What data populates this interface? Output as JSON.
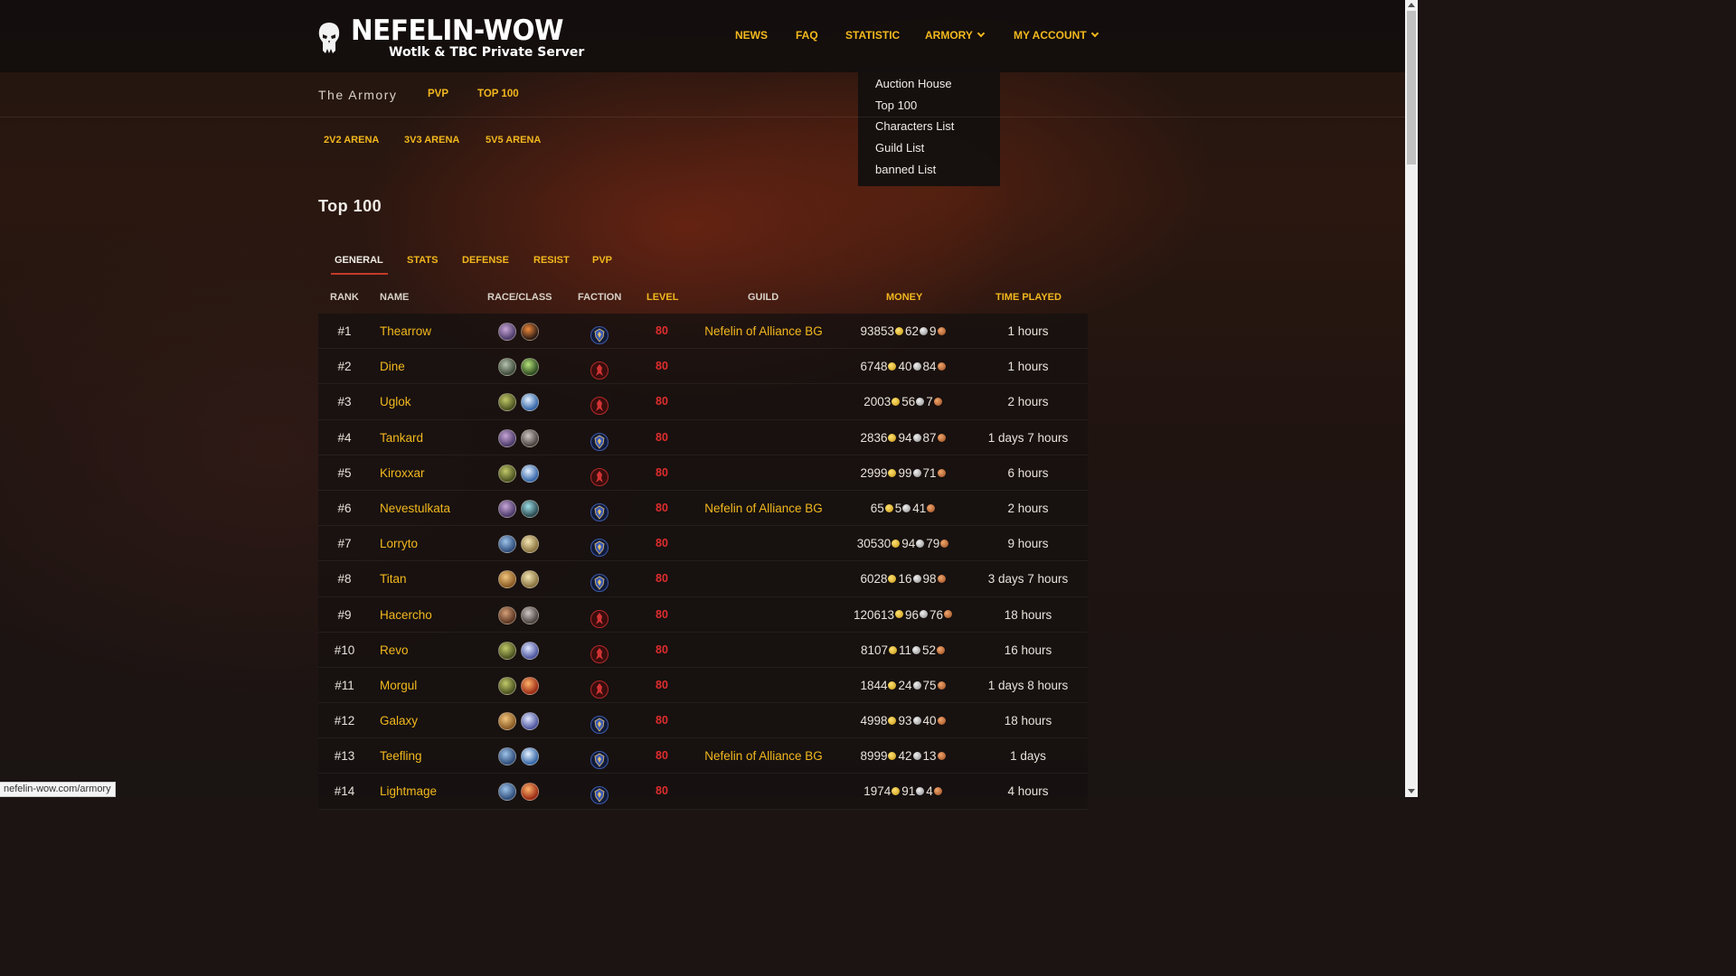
{
  "logo": {
    "title": "NEFELIN-WOW",
    "subtitle": "Wotlk & TBC Private Server"
  },
  "nav": {
    "news": "NEWS",
    "faq": "FAQ",
    "statistic": "STATISTIC",
    "armory": "ARMORY",
    "account": "MY ACCOUNT"
  },
  "dropdown": [
    "Auction House",
    "Top 100",
    "Characters List",
    "Guild List",
    "banned List"
  ],
  "subbar": {
    "title": "The Armory",
    "pvp": "PVP",
    "top100": "TOP 100"
  },
  "arena": [
    "2V2 ARENA",
    "3V3 ARENA",
    "5V5 ARENA"
  ],
  "page_title": "Top 100",
  "tabs": [
    "GENERAL",
    "STATS",
    "DEFENSE",
    "RESIST",
    "PVP"
  ],
  "columns": {
    "rank": "RANK",
    "name": "NAME",
    "raceclass": "RACE/CLASS",
    "faction": "FACTION",
    "level": "LEVEL",
    "guild": "GUILD",
    "money": "MONEY",
    "time": "TIME PLAYED"
  },
  "colors": {
    "accent": "#f2b81e",
    "level": "#e02d2d",
    "tab_underline": "#c43b2a"
  },
  "rows": [
    {
      "rank": "#1",
      "name": "Thearrow",
      "race": "race-draenei",
      "cls": "class-rogue",
      "faction": "alliance",
      "level": "80",
      "guild": "Nefelin of Alliance BG",
      "gold": "93853",
      "silver": "62",
      "copper": "9",
      "time": "1 hours"
    },
    {
      "rank": "#2",
      "name": "Dine",
      "race": "race-undead",
      "cls": "class-hunter",
      "faction": "horde",
      "level": "80",
      "guild": "",
      "gold": "6748",
      "silver": "40",
      "copper": "84",
      "time": "1 hours"
    },
    {
      "rank": "#3",
      "name": "Uglok",
      "race": "race-orc",
      "cls": "class-shaman",
      "faction": "horde",
      "level": "80",
      "guild": "",
      "gold": "2003",
      "silver": "56",
      "copper": "7",
      "time": "2 hours"
    },
    {
      "rank": "#4",
      "name": "Tankard",
      "race": "race-draenei",
      "cls": "class-warrior",
      "faction": "alliance",
      "level": "80",
      "guild": "",
      "gold": "2836",
      "silver": "94",
      "copper": "87",
      "time": "1 days 7 hours"
    },
    {
      "rank": "#5",
      "name": "Kiroxxar",
      "race": "race-orc",
      "cls": "class-shaman",
      "faction": "horde",
      "level": "80",
      "guild": "",
      "gold": "2999",
      "silver": "99",
      "copper": "71",
      "time": "6 hours"
    },
    {
      "rank": "#6",
      "name": "Nevestulkata",
      "race": "race-draenei",
      "cls": "class-deathknight",
      "faction": "alliance",
      "level": "80",
      "guild": "Nefelin of Alliance BG",
      "gold": "65",
      "silver": "5",
      "copper": "41",
      "time": "2 hours"
    },
    {
      "rank": "#7",
      "name": "Lorryto",
      "race": "race-gnome",
      "cls": "class-paladin",
      "faction": "alliance",
      "level": "80",
      "guild": "",
      "gold": "30530",
      "silver": "94",
      "copper": "79",
      "time": "9 hours"
    },
    {
      "rank": "#8",
      "name": "Titan",
      "race": "race-human",
      "cls": "class-paladin",
      "faction": "alliance",
      "level": "80",
      "guild": "",
      "gold": "6028",
      "silver": "16",
      "copper": "98",
      "time": "3 days 7 hours"
    },
    {
      "rank": "#9",
      "name": "Hacercho",
      "race": "race-tauren",
      "cls": "class-warrior",
      "faction": "horde",
      "level": "80",
      "guild": "",
      "gold": "120613",
      "silver": "96",
      "copper": "76",
      "time": "18 hours"
    },
    {
      "rank": "#10",
      "name": "Revo",
      "race": "race-orc",
      "cls": "class-priest",
      "faction": "horde",
      "level": "80",
      "guild": "",
      "gold": "8107",
      "silver": "11",
      "copper": "52",
      "time": "16 hours"
    },
    {
      "rank": "#11",
      "name": "Morgul",
      "race": "race-orc",
      "cls": "class-mage",
      "faction": "horde",
      "level": "80",
      "guild": "",
      "gold": "1844",
      "silver": "24",
      "copper": "75",
      "time": "1 days 8 hours"
    },
    {
      "rank": "#12",
      "name": "Galaxy",
      "race": "race-human",
      "cls": "class-priest",
      "faction": "alliance",
      "level": "80",
      "guild": "",
      "gold": "4998",
      "silver": "93",
      "copper": "40",
      "time": "18 hours"
    },
    {
      "rank": "#13",
      "name": "Teefling",
      "race": "race-gnome",
      "cls": "class-shaman",
      "faction": "alliance",
      "level": "80",
      "guild": "Nefelin of Alliance BG",
      "gold": "8999",
      "silver": "42",
      "copper": "13",
      "time": "1 days"
    },
    {
      "rank": "#14",
      "name": "Lightmage",
      "race": "race-gnome",
      "cls": "class-mage",
      "faction": "alliance",
      "level": "80",
      "guild": "",
      "gold": "1974",
      "silver": "91",
      "copper": "4",
      "time": "4 hours"
    }
  ],
  "status_url": "nefelin-wow.com/armory"
}
